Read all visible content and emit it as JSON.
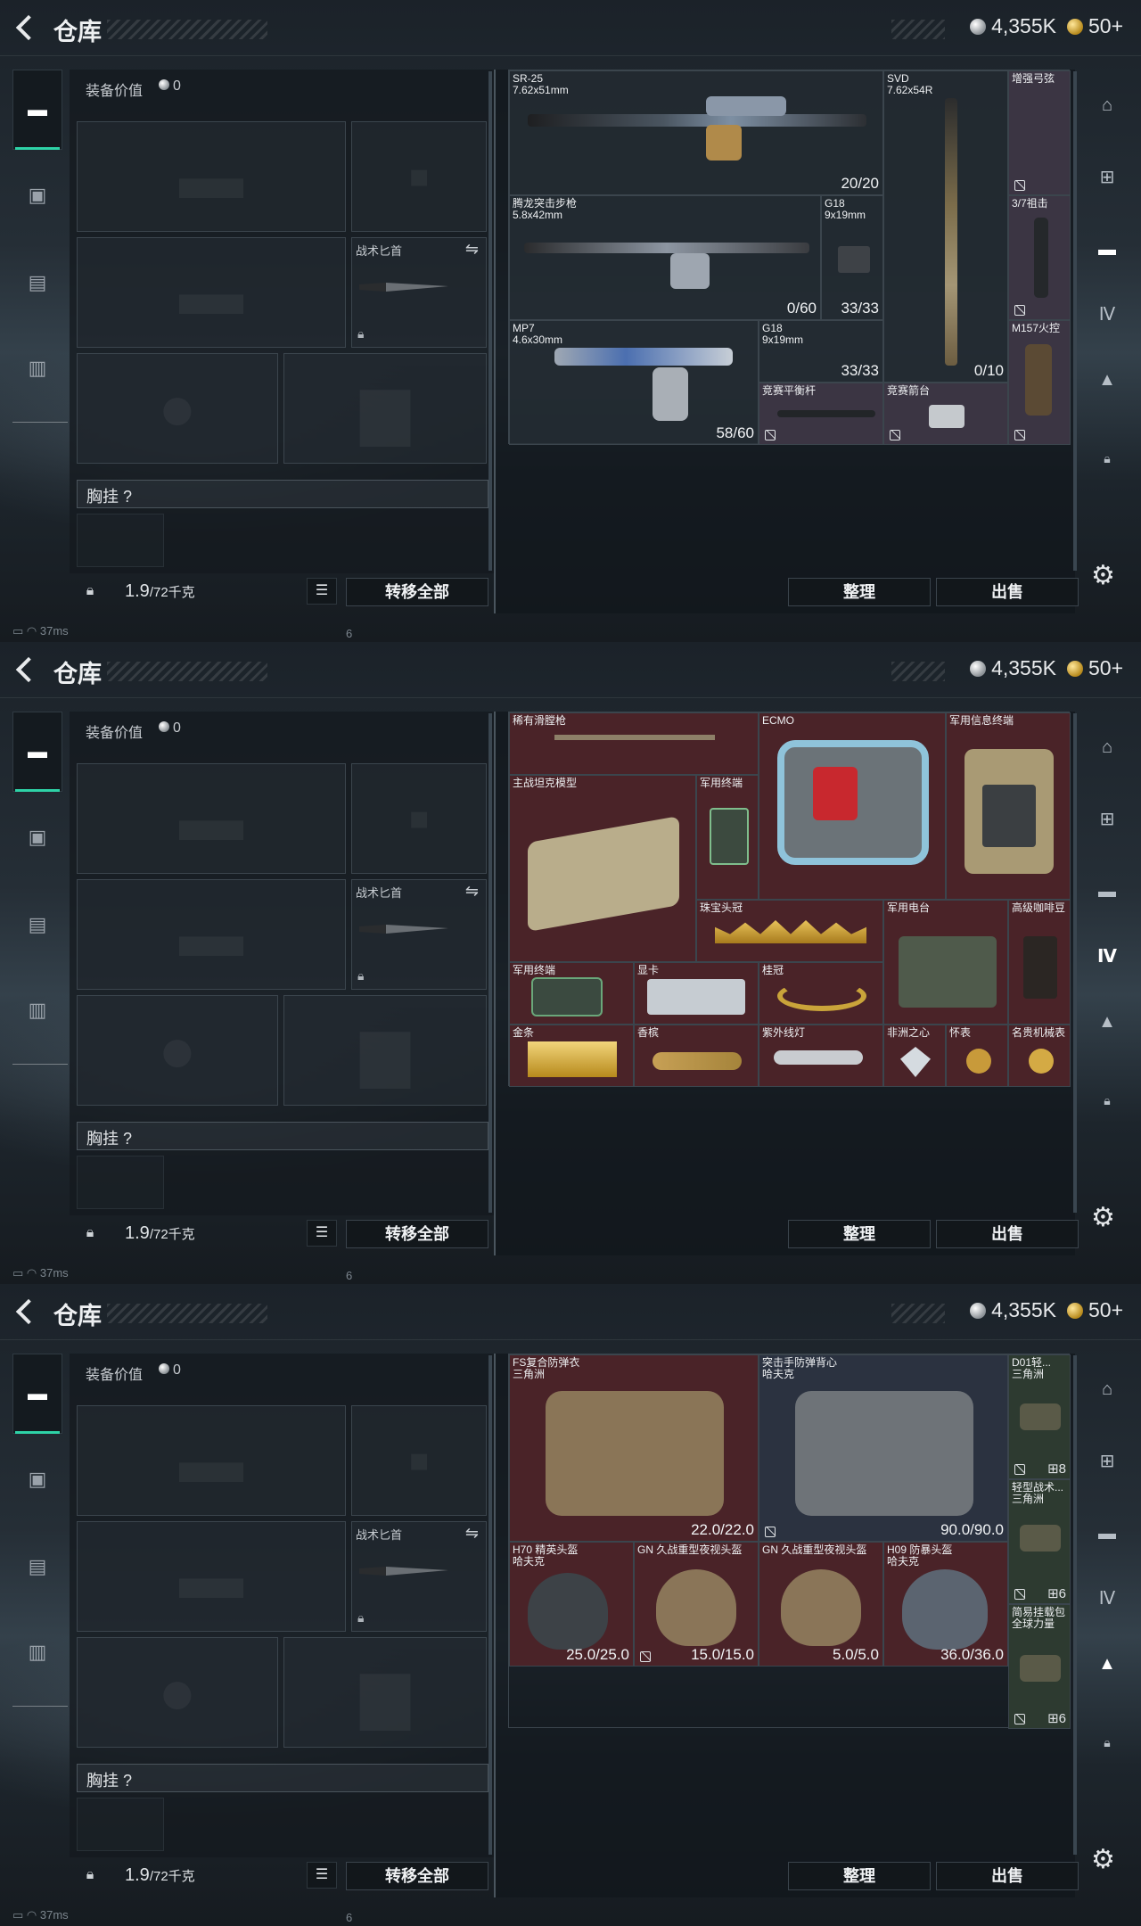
{
  "topbar": {
    "title": "仓库",
    "silver": "4,355K",
    "gold": "50+"
  },
  "equip": {
    "label": "装备价值",
    "value": "0",
    "knife_label": "战术匕首",
    "chest_label": "胸挂",
    "chest_help": "?",
    "weight": "1.9",
    "weight_unit": "/72千克",
    "transfer": "转移全部"
  },
  "actions": {
    "sort": "整理",
    "sell": "出售"
  },
  "status": {
    "ping": "37ms",
    "marker": "6"
  },
  "panel1": {
    "items": [
      {
        "name": "SR-25\n7.62x51mm",
        "qty": "20/20"
      },
      {
        "name": "SVD\n7.62x54R",
        "qty": "0/10"
      },
      {
        "name": "增强弓弦"
      },
      {
        "name": "腾龙突击步枪\n5.8x42mm",
        "qty": "0/60"
      },
      {
        "name": "G18\n9x19mm",
        "qty": "33/33"
      },
      {
        "name": "3/7祖击"
      },
      {
        "name": "MP7\n4.6x30mm",
        "qty": "58/60"
      },
      {
        "name": "G18\n9x19mm",
        "qty": "33/33"
      },
      {
        "name": "M157火控"
      },
      {
        "name": "竞赛平衡杆"
      },
      {
        "name": "竞赛箭台"
      }
    ]
  },
  "panel2": {
    "items": [
      {
        "name": "稀有滑膛枪"
      },
      {
        "name": "ECMO"
      },
      {
        "name": "军用信息终端"
      },
      {
        "name": "主战坦克模型"
      },
      {
        "name": "军用终端"
      },
      {
        "name": "珠宝头冠"
      },
      {
        "name": "军用电台"
      },
      {
        "name": "高级咖啡豆"
      },
      {
        "name": "军用终端"
      },
      {
        "name": "显卡"
      },
      {
        "name": "桂冠"
      },
      {
        "name": "金条"
      },
      {
        "name": "香槟"
      },
      {
        "name": "紫外线灯"
      },
      {
        "name": "非洲之心"
      },
      {
        "name": "怀表"
      },
      {
        "name": "名贵机械表"
      }
    ]
  },
  "panel3": {
    "items": [
      {
        "name": "FS复合防弹衣\n三角洲",
        "dur": "22.0/22.0"
      },
      {
        "name": "突击手防弹背心\n哈夫克",
        "dur": "90.0/90.0"
      },
      {
        "name": "D01轻...\n三角洲",
        "stack": "8"
      },
      {
        "name": "轻型战术...\n三角洲",
        "stack": "6"
      },
      {
        "name": "H70 精英头盔\n哈夫克",
        "dur": "25.0/25.0"
      },
      {
        "name": "GN 久战重型夜视头盔",
        "dur": "15.0/15.0"
      },
      {
        "name": "GN 久战重型夜视头盔",
        "dur": "5.0/5.0"
      },
      {
        "name": "H09 防暴头盔\n哈夫克",
        "dur": "36.0/36.0"
      },
      {
        "name": "简易挂载包\n全球力量",
        "stack": "6"
      }
    ]
  }
}
